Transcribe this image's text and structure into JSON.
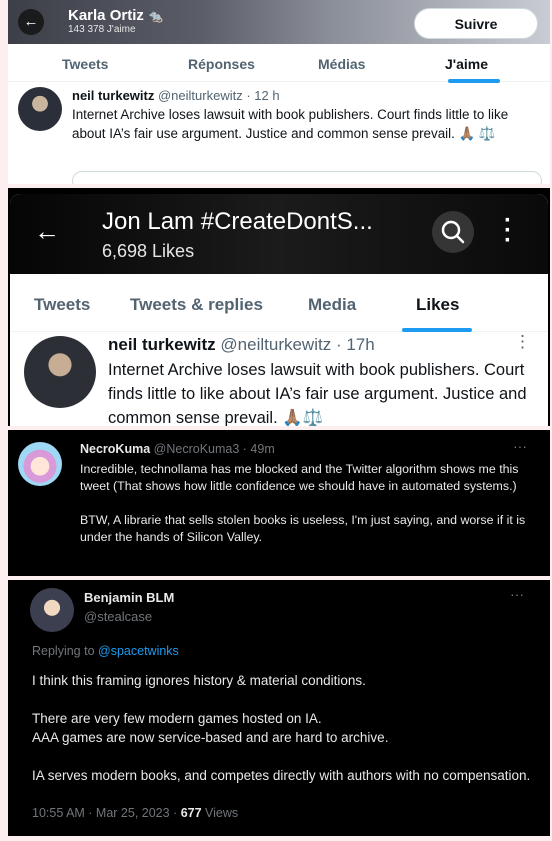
{
  "panel1": {
    "back_icon": "arrow-left-icon",
    "profile_name": "Karla Ortiz",
    "badge_icon": "rat-emoji-icon",
    "likes_count": "143 378 J'aime",
    "follow_label": "Suivre",
    "tabs": [
      {
        "label": "Tweets"
      },
      {
        "label": "Réponses"
      },
      {
        "label": "Médias"
      },
      {
        "label": "J'aime",
        "active": true
      }
    ],
    "tweet": {
      "name": "neil turkewitz",
      "handle": "@neilturkewitz",
      "time": "· 12 h",
      "text": "Internet Archive loses lawsuit with book publishers. Court finds little to like about IA’s fair use argument. Justice and common sense prevail. 🙏🏽 ⚖️"
    }
  },
  "panel2": {
    "back_icon": "arrow-left-icon",
    "profile_name": "Jon Lam #CreateDontS...",
    "likes_count": "6,698 Likes",
    "search_icon": "search-icon",
    "more_icon": "more-vertical-icon",
    "tabs": [
      {
        "label": "Tweets"
      },
      {
        "label": "Tweets & replies"
      },
      {
        "label": "Media"
      },
      {
        "label": "Likes",
        "active": true
      }
    ],
    "tweet": {
      "name": "neil turkewitz",
      "handle": "@neilturkewitz",
      "time": "· 17h",
      "text": "Internet Archive loses lawsuit with book publishers. Court finds little to like about IA’s fair use argument. Justice and common sense prevail. 🙏🏽⚖️"
    }
  },
  "panel3": {
    "name": "NecroKuma",
    "handle": "@NecroKuma3",
    "time": "· 49m",
    "para1": "Incredible, technollama has me blocked and the Twitter algorithm shows me this tweet (That shows how little confidence we should have in automated systems.)",
    "para2": "BTW, A librarie that sells stolen books is useless, I'm just saying, and worse if it is under the hands of Silicon Valley."
  },
  "panel4": {
    "name": "Benjamin BLM",
    "handle": "@stealcase",
    "reply_prefix": "Replying to",
    "reply_to": "@spacetwinks",
    "para1": "I think this framing ignores history & material conditions.",
    "para2a": "There are very few modern games hosted on IA.",
    "para2b": "AAA games are now service-based and are hard to archive.",
    "para3": "IA serves modern books, and competes directly with authors with no compensation.",
    "timestamp": "10:55 AM · Mar 25, 2023 ·",
    "views_count": "677",
    "views_label": "Views"
  },
  "colors": {
    "accent": "#1d9bf0",
    "dark_bg": "#000000",
    "light_bg": "#ffffff",
    "page_bg": "#fdeef0"
  }
}
